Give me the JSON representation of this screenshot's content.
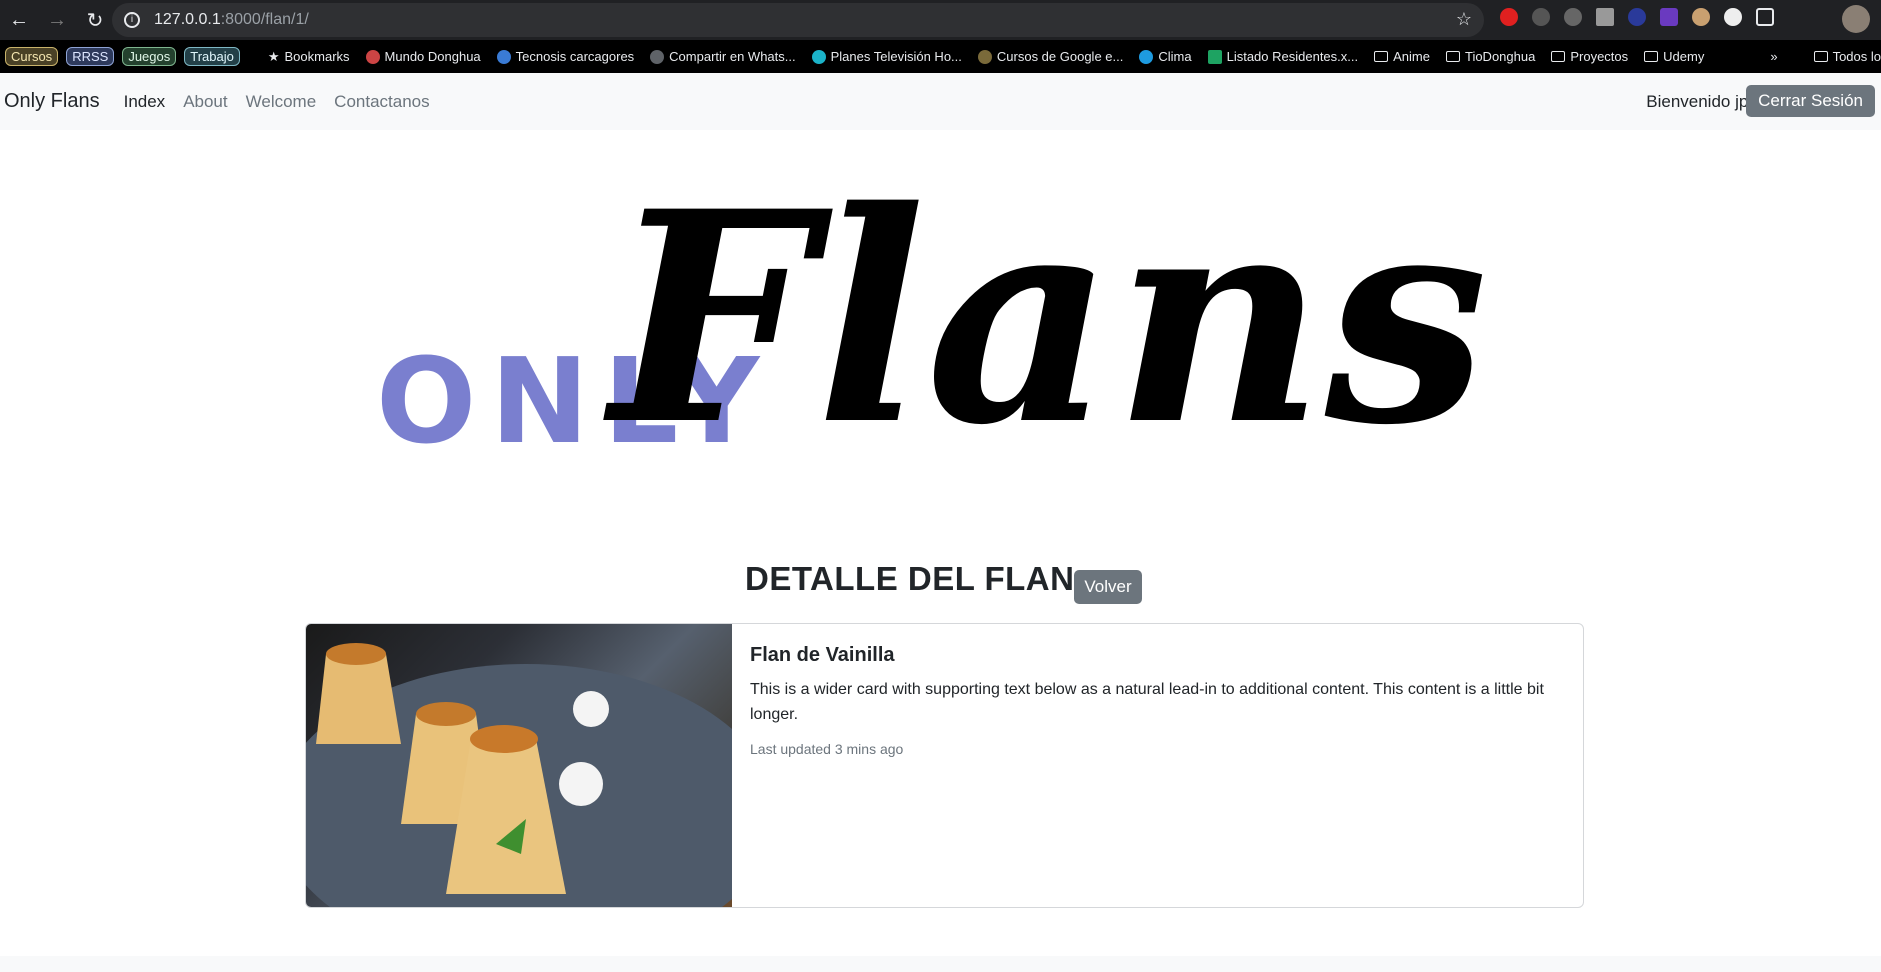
{
  "browser": {
    "url_host": "127.0.0.1",
    "url_path": ":8000/flan/1/"
  },
  "bookmarks": {
    "tags": [
      {
        "label": "Cursos",
        "color": "#c9b36b"
      },
      {
        "label": "RRSS",
        "color": "#8fa4d6"
      },
      {
        "label": "Juegos",
        "color": "#7fb58f"
      },
      {
        "label": "Trabajo",
        "color": "#7fb8c4"
      }
    ],
    "items": [
      "Bookmarks",
      "Mundo Donghua",
      "Tecnosis carcagores",
      "Compartir en Whats...",
      "Planes Televisión Ho...",
      "Cursos de Google e...",
      "Clima",
      "Listado Residentes.x..."
    ],
    "folders": [
      "Anime",
      "TioDonghua",
      "Proyectos",
      "Udemy"
    ],
    "more": "»",
    "all": "Todos los marcado"
  },
  "nav": {
    "brand": "Only Flans",
    "links": [
      "Index",
      "About",
      "Welcome",
      "Contactanos"
    ],
    "welcome": "Bienvenido jpsm",
    "logout": "Cerrar Sesión"
  },
  "logo": {
    "only": "ONLY",
    "flans": "Flans",
    "only_color": "#7a7fcf"
  },
  "main": {
    "heading": "DETALLE DEL FLAN",
    "back": "Volver"
  },
  "card": {
    "title": "Flan de Vainilla",
    "text": "This is a wider card with supporting text below as a natural lead-in to additional content. This content is a little bit longer.",
    "updated": "Last updated 3 mins ago"
  }
}
